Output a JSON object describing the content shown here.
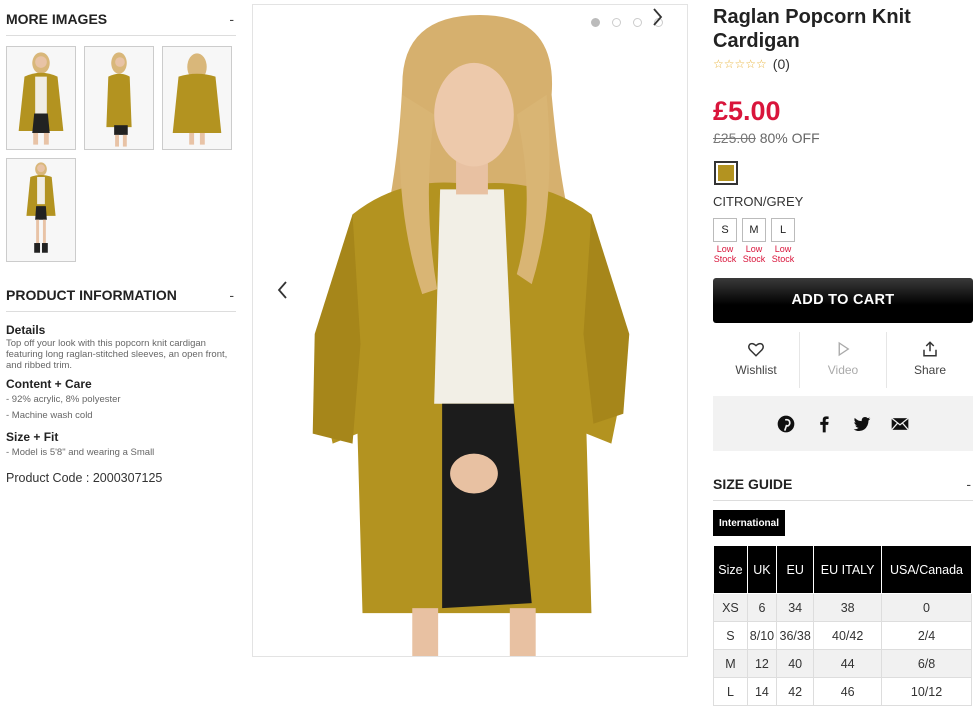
{
  "more_images": {
    "title": "MORE IMAGES",
    "toggle": "-"
  },
  "product_info": {
    "title": "PRODUCT INFORMATION",
    "toggle": "-",
    "details_heading": "Details",
    "details_text": "Top off your look with this popcorn knit cardigan featuring long raglan-stitched sleeves, an open front, and ribbed trim.",
    "care_heading": "Content + Care",
    "care_lines": [
      "- 92% acrylic, 8% polyester",
      "- Machine wash cold"
    ],
    "fit_heading": "Size + Fit",
    "fit_lines": [
      "- Model is 5'8\" and wearing a Small"
    ],
    "product_code": "Product Code : 2000307125"
  },
  "product": {
    "title": "Raglan Popcorn Knit Cardigan",
    "stars": "☆☆☆☆☆",
    "review_count": "(0)",
    "price": "£5.00",
    "original_price": "£25.00",
    "discount": "80% OFF",
    "color_name": "CITRON/GREY",
    "swatch_color": "#b39320",
    "sizes": [
      {
        "label": "S",
        "stock": "Low Stock"
      },
      {
        "label": "M",
        "stock": "Low Stock"
      },
      {
        "label": "L",
        "stock": "Low Stock"
      }
    ],
    "add_to_cart": "ADD TO CART",
    "actions": {
      "wishlist": "Wishlist",
      "video": "Video",
      "share": "Share"
    }
  },
  "size_guide": {
    "title": "SIZE GUIDE",
    "toggle": "-",
    "tab": "International",
    "headers": [
      "Size",
      "UK",
      "EU",
      "EU ITALY",
      "USA/Canada"
    ],
    "rows": [
      [
        "XS",
        "6",
        "34",
        "38",
        "0"
      ],
      [
        "S",
        "8/10",
        "36/38",
        "40/42",
        "2/4"
      ],
      [
        "M",
        "12",
        "40",
        "44",
        "6/8"
      ],
      [
        "L",
        "14",
        "42",
        "46",
        "10/12"
      ]
    ]
  },
  "colors": {
    "accent": "#d9153b",
    "cardigan": "#b39320",
    "button": "#000000"
  }
}
